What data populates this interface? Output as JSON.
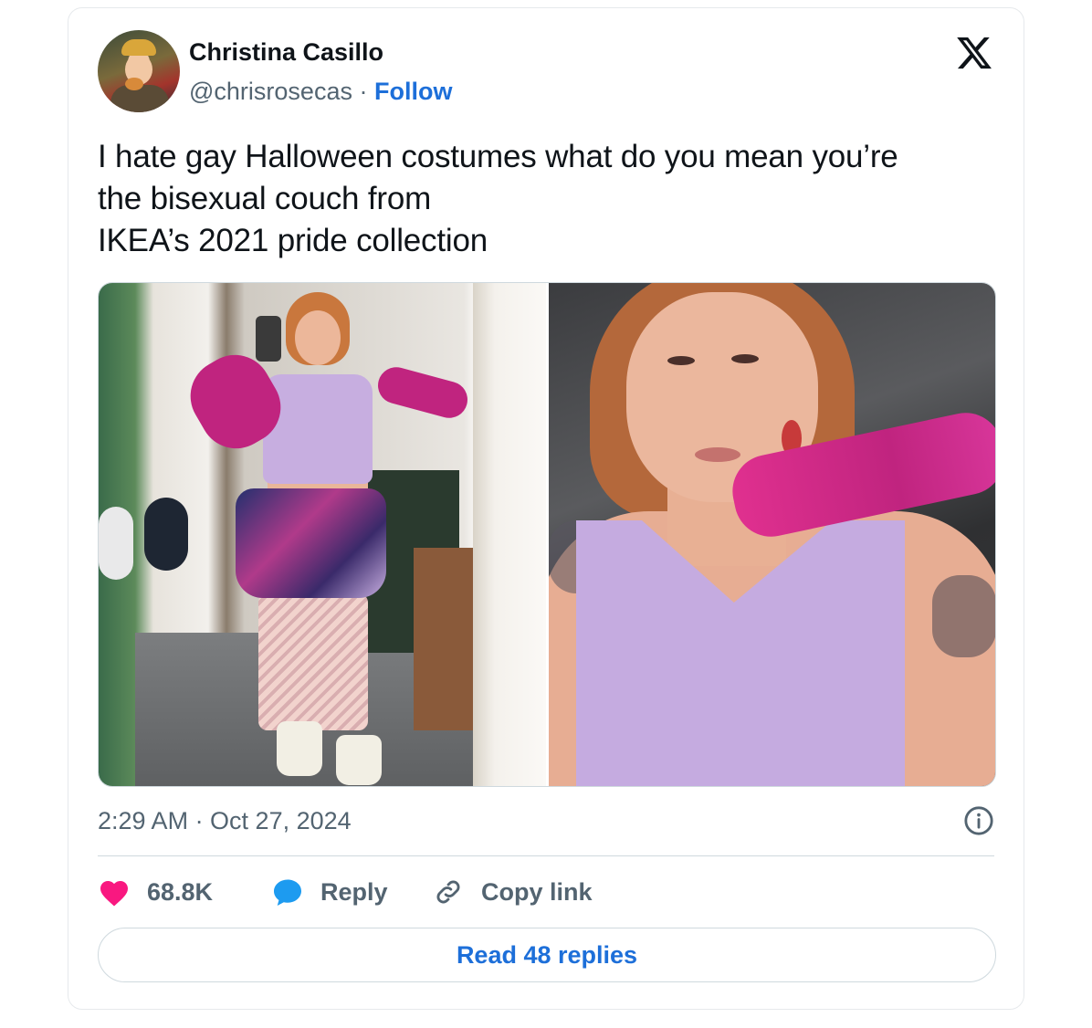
{
  "author": {
    "name": "Christina Casillo",
    "handle": "@chrisrosecas",
    "separator": " · ",
    "follow_label": "Follow"
  },
  "tweet": {
    "lines": [
      "I hate gay Halloween costumes what do you mean you’re",
      "the bisexual couch from",
      "IKEA’s 2021 pride collection"
    ],
    "timestamp": "2:29 AM · Oct 27, 2024"
  },
  "media": {
    "photos": [
      {
        "label": "mirror selfie in costume"
      },
      {
        "label": "close-up selfie in costume"
      }
    ]
  },
  "actions": {
    "likes": "68.8K",
    "reply_label": "Reply",
    "copy_label": "Copy link"
  },
  "read_replies_label": "Read 48 replies",
  "colors": {
    "accent": "#1d6fd9",
    "like": "#f91880",
    "reply_icon": "#1d9bf0",
    "muted": "#536471"
  },
  "icons": {
    "brand": "x-logo-icon",
    "info": "info-icon",
    "like": "heart-icon",
    "reply": "speech-bubble-icon",
    "copy": "link-icon"
  }
}
